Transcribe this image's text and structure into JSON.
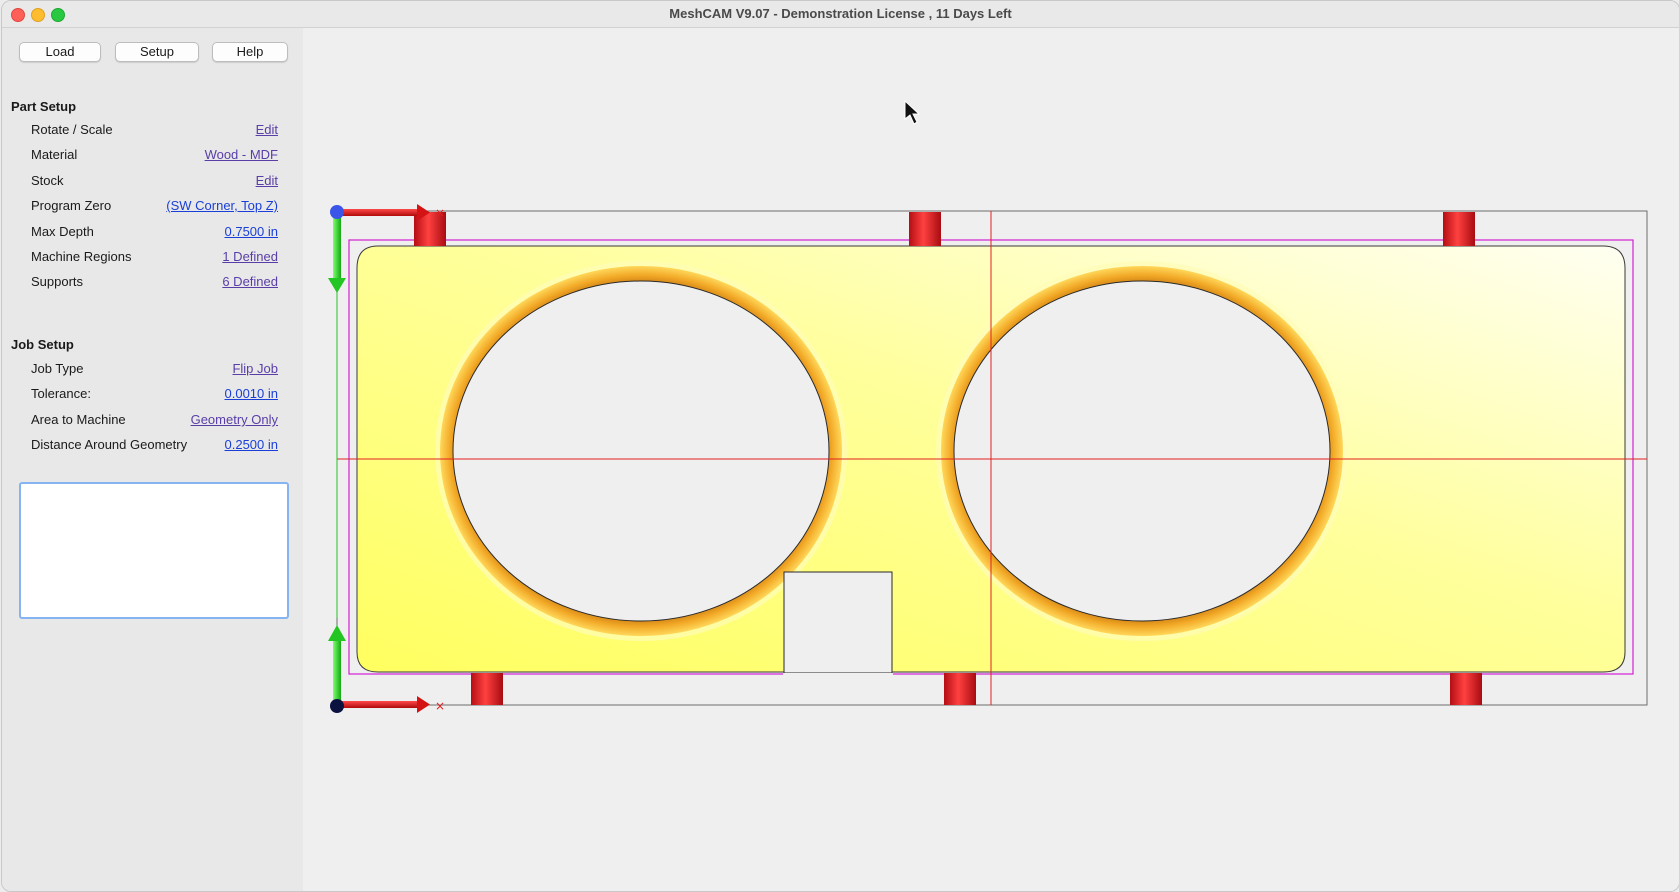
{
  "window": {
    "title": "MeshCAM V9.07 - Demonstration License  , 11 Days Left"
  },
  "toolbar": {
    "load_label": "Load",
    "setup_label": "Setup",
    "help_label": "Help"
  },
  "part_setup": {
    "title": "Part Setup",
    "rows": [
      {
        "label": "Rotate / Scale",
        "value": "Edit"
      },
      {
        "label": "Material",
        "value": "Wood - MDF"
      },
      {
        "label": "Stock",
        "value": "Edit"
      },
      {
        "label": "Program Zero",
        "value": "(SW Corner, Top Z)"
      },
      {
        "label": "Max Depth",
        "value": "0.7500 in"
      },
      {
        "label": "Machine Regions",
        "value": "1 Defined"
      },
      {
        "label": "Supports",
        "value": "6 Defined"
      }
    ]
  },
  "job_setup": {
    "title": "Job Setup",
    "rows": [
      {
        "label": "Job Type",
        "value": "Flip Job"
      },
      {
        "label": "Tolerance:",
        "value": "0.0010 in"
      },
      {
        "label": "Area to Machine",
        "value": "Geometry Only"
      },
      {
        "label": "Distance Around Geometry",
        "value": "0.2500 in"
      }
    ]
  },
  "colors": {
    "part_fill": "#ffff70",
    "ring": "#e89a1a",
    "support": "#e81e26",
    "boundary": "#d21ed2",
    "crosshair": "#e02020",
    "axis_x": "#e01414",
    "axis_y": "#1ed21e",
    "link_visited": "#5a3ea8",
    "link": "#1a3fd8"
  },
  "icons": [
    "close-window-icon",
    "minimize-window-icon",
    "maximize-window-icon",
    "mouse-cursor-icon",
    "x-axis-arrow-icon",
    "y-axis-arrow-icon",
    "origin-marker-icon"
  ]
}
